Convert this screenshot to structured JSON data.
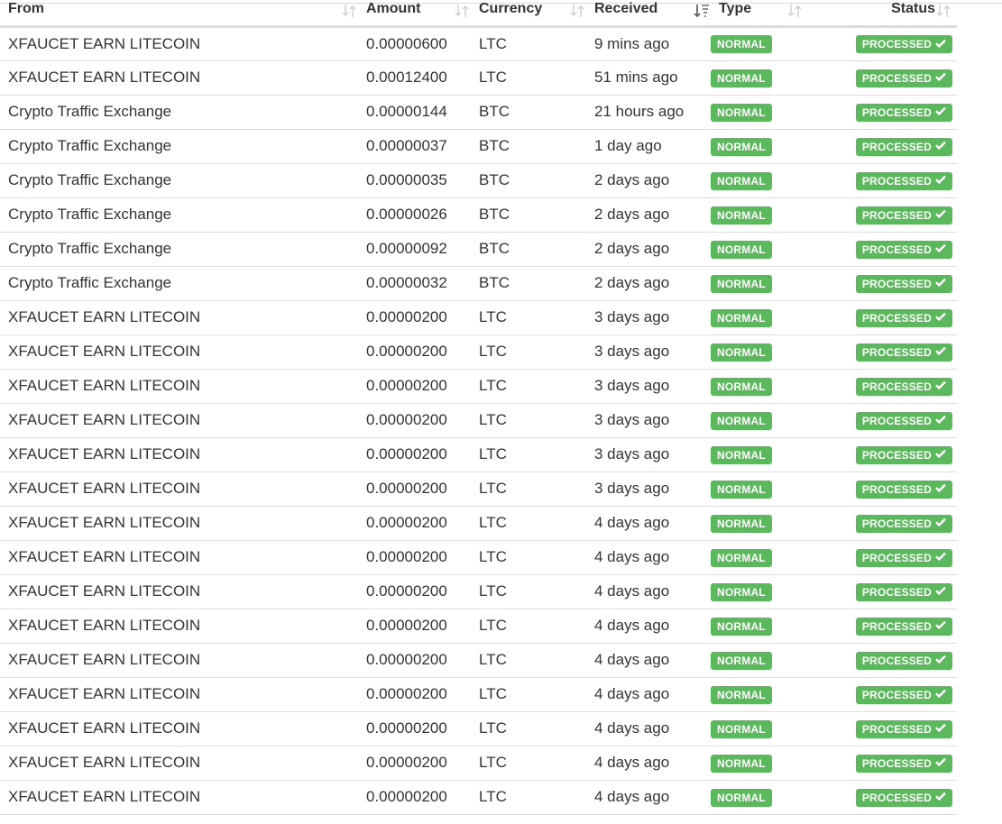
{
  "table": {
    "columns": [
      {
        "key": "from",
        "label": "From"
      },
      {
        "key": "amount",
        "label": "Amount"
      },
      {
        "key": "currency",
        "label": "Currency"
      },
      {
        "key": "received",
        "label": "Received"
      },
      {
        "key": "type",
        "label": "Type"
      },
      {
        "key": "status",
        "label": "Status"
      }
    ],
    "sort": {
      "column": "received",
      "direction": "descending"
    },
    "badge_color": "#5cb85c",
    "rows": [
      {
        "from": "XFAUCET EARN LITECOIN",
        "amount": "0.00000600",
        "currency": "LTC",
        "received": "9 mins ago",
        "type": "NORMAL",
        "status": "PROCESSED"
      },
      {
        "from": "XFAUCET EARN LITECOIN",
        "amount": "0.00012400",
        "currency": "LTC",
        "received": "51 mins ago",
        "type": "NORMAL",
        "status": "PROCESSED"
      },
      {
        "from": "Crypto Traffic Exchange",
        "amount": "0.00000144",
        "currency": "BTC",
        "received": "21 hours ago",
        "type": "NORMAL",
        "status": "PROCESSED"
      },
      {
        "from": "Crypto Traffic Exchange",
        "amount": "0.00000037",
        "currency": "BTC",
        "received": "1 day ago",
        "type": "NORMAL",
        "status": "PROCESSED"
      },
      {
        "from": "Crypto Traffic Exchange",
        "amount": "0.00000035",
        "currency": "BTC",
        "received": "2 days ago",
        "type": "NORMAL",
        "status": "PROCESSED"
      },
      {
        "from": "Crypto Traffic Exchange",
        "amount": "0.00000026",
        "currency": "BTC",
        "received": "2 days ago",
        "type": "NORMAL",
        "status": "PROCESSED"
      },
      {
        "from": "Crypto Traffic Exchange",
        "amount": "0.00000092",
        "currency": "BTC",
        "received": "2 days ago",
        "type": "NORMAL",
        "status": "PROCESSED"
      },
      {
        "from": "Crypto Traffic Exchange",
        "amount": "0.00000032",
        "currency": "BTC",
        "received": "2 days ago",
        "type": "NORMAL",
        "status": "PROCESSED"
      },
      {
        "from": "XFAUCET EARN LITECOIN",
        "amount": "0.00000200",
        "currency": "LTC",
        "received": "3 days ago",
        "type": "NORMAL",
        "status": "PROCESSED"
      },
      {
        "from": "XFAUCET EARN LITECOIN",
        "amount": "0.00000200",
        "currency": "LTC",
        "received": "3 days ago",
        "type": "NORMAL",
        "status": "PROCESSED"
      },
      {
        "from": "XFAUCET EARN LITECOIN",
        "amount": "0.00000200",
        "currency": "LTC",
        "received": "3 days ago",
        "type": "NORMAL",
        "status": "PROCESSED"
      },
      {
        "from": "XFAUCET EARN LITECOIN",
        "amount": "0.00000200",
        "currency": "LTC",
        "received": "3 days ago",
        "type": "NORMAL",
        "status": "PROCESSED"
      },
      {
        "from": "XFAUCET EARN LITECOIN",
        "amount": "0.00000200",
        "currency": "LTC",
        "received": "3 days ago",
        "type": "NORMAL",
        "status": "PROCESSED"
      },
      {
        "from": "XFAUCET EARN LITECOIN",
        "amount": "0.00000200",
        "currency": "LTC",
        "received": "3 days ago",
        "type": "NORMAL",
        "status": "PROCESSED"
      },
      {
        "from": "XFAUCET EARN LITECOIN",
        "amount": "0.00000200",
        "currency": "LTC",
        "received": "4 days ago",
        "type": "NORMAL",
        "status": "PROCESSED"
      },
      {
        "from": "XFAUCET EARN LITECOIN",
        "amount": "0.00000200",
        "currency": "LTC",
        "received": "4 days ago",
        "type": "NORMAL",
        "status": "PROCESSED"
      },
      {
        "from": "XFAUCET EARN LITECOIN",
        "amount": "0.00000200",
        "currency": "LTC",
        "received": "4 days ago",
        "type": "NORMAL",
        "status": "PROCESSED"
      },
      {
        "from": "XFAUCET EARN LITECOIN",
        "amount": "0.00000200",
        "currency": "LTC",
        "received": "4 days ago",
        "type": "NORMAL",
        "status": "PROCESSED"
      },
      {
        "from": "XFAUCET EARN LITECOIN",
        "amount": "0.00000200",
        "currency": "LTC",
        "received": "4 days ago",
        "type": "NORMAL",
        "status": "PROCESSED"
      },
      {
        "from": "XFAUCET EARN LITECOIN",
        "amount": "0.00000200",
        "currency": "LTC",
        "received": "4 days ago",
        "type": "NORMAL",
        "status": "PROCESSED"
      },
      {
        "from": "XFAUCET EARN LITECOIN",
        "amount": "0.00000200",
        "currency": "LTC",
        "received": "4 days ago",
        "type": "NORMAL",
        "status": "PROCESSED"
      },
      {
        "from": "XFAUCET EARN LITECOIN",
        "amount": "0.00000200",
        "currency": "LTC",
        "received": "4 days ago",
        "type": "NORMAL",
        "status": "PROCESSED"
      },
      {
        "from": "XFAUCET EARN LITECOIN",
        "amount": "0.00000200",
        "currency": "LTC",
        "received": "4 days ago",
        "type": "NORMAL",
        "status": "PROCESSED"
      }
    ]
  }
}
